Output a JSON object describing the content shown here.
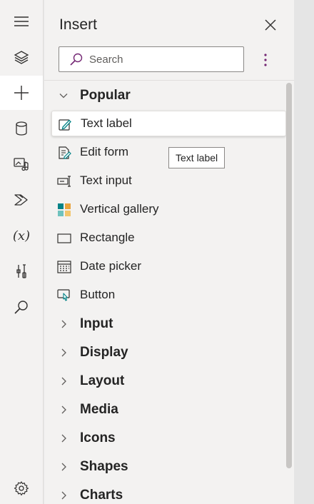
{
  "rail": {
    "items": [
      {
        "icon": "hamburger-icon",
        "active": false
      },
      {
        "icon": "layers-icon",
        "active": false
      },
      {
        "icon": "plus-icon",
        "active": true
      },
      {
        "icon": "database-icon",
        "active": false
      },
      {
        "icon": "media-icon",
        "active": false
      },
      {
        "icon": "power-automate-icon",
        "active": false
      },
      {
        "icon": "variables-icon",
        "active": false,
        "text": "(x)"
      },
      {
        "icon": "tools-icon",
        "active": false
      },
      {
        "icon": "search-icon",
        "active": false
      },
      {
        "icon": "settings-icon",
        "active": false
      }
    ]
  },
  "panel": {
    "title": "Insert",
    "close_icon": "close-icon",
    "more_icon": "more-vertical-icon"
  },
  "search": {
    "placeholder": "Search",
    "value": ""
  },
  "tooltip": {
    "text": "Text label"
  },
  "tree": {
    "popular": {
      "label": "Popular",
      "expanded": true,
      "items": [
        {
          "label": "Text label",
          "icon": "text-label-icon",
          "selected": true
        },
        {
          "label": "Edit form",
          "icon": "edit-form-icon",
          "selected": false
        },
        {
          "label": "Text input",
          "icon": "text-input-icon",
          "selected": false
        },
        {
          "label": "Vertical gallery",
          "icon": "gallery-icon",
          "selected": false
        },
        {
          "label": "Rectangle",
          "icon": "rectangle-icon",
          "selected": false
        },
        {
          "label": "Date picker",
          "icon": "calendar-icon",
          "selected": false
        },
        {
          "label": "Button",
          "icon": "button-icon",
          "selected": false
        }
      ]
    },
    "categories": [
      {
        "label": "Input",
        "expanded": false
      },
      {
        "label": "Display",
        "expanded": false
      },
      {
        "label": "Layout",
        "expanded": false
      },
      {
        "label": "Media",
        "expanded": false
      },
      {
        "label": "Icons",
        "expanded": false
      },
      {
        "label": "Shapes",
        "expanded": false
      },
      {
        "label": "Charts",
        "expanded": false
      }
    ]
  },
  "colors": {
    "accent": "#742774",
    "teal": "#038387",
    "panel_bg": "#f3f2f1"
  }
}
